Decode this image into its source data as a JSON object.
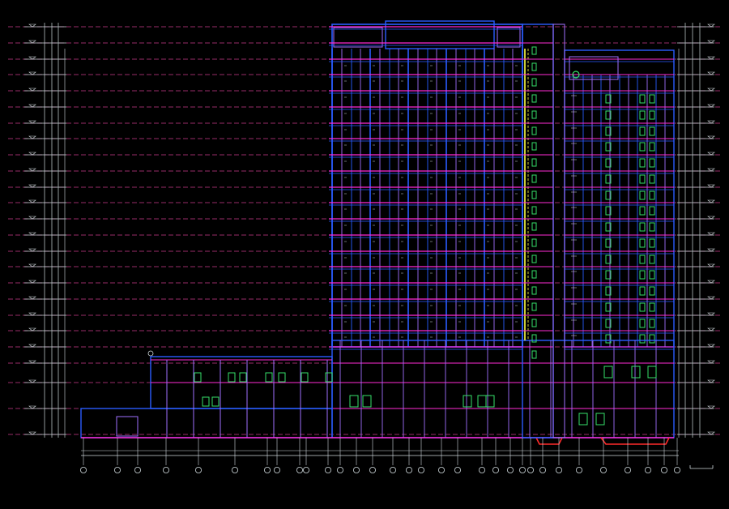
{
  "colors": {
    "background": "#000000",
    "level_line": "#cc3a8a",
    "dim_line": "#cfd8dc",
    "wall": "#2a5cff",
    "frame": "#a070ff",
    "slab": "#ff2bd6",
    "window": "#36e06a",
    "stair": "#ffff44",
    "accent_red": "#ff2a2a"
  },
  "icons": {
    "level_marker": "level-marker-icon",
    "axis_bubble": "axis-bubble-icon",
    "section_symbol": "section-symbol-icon"
  }
}
